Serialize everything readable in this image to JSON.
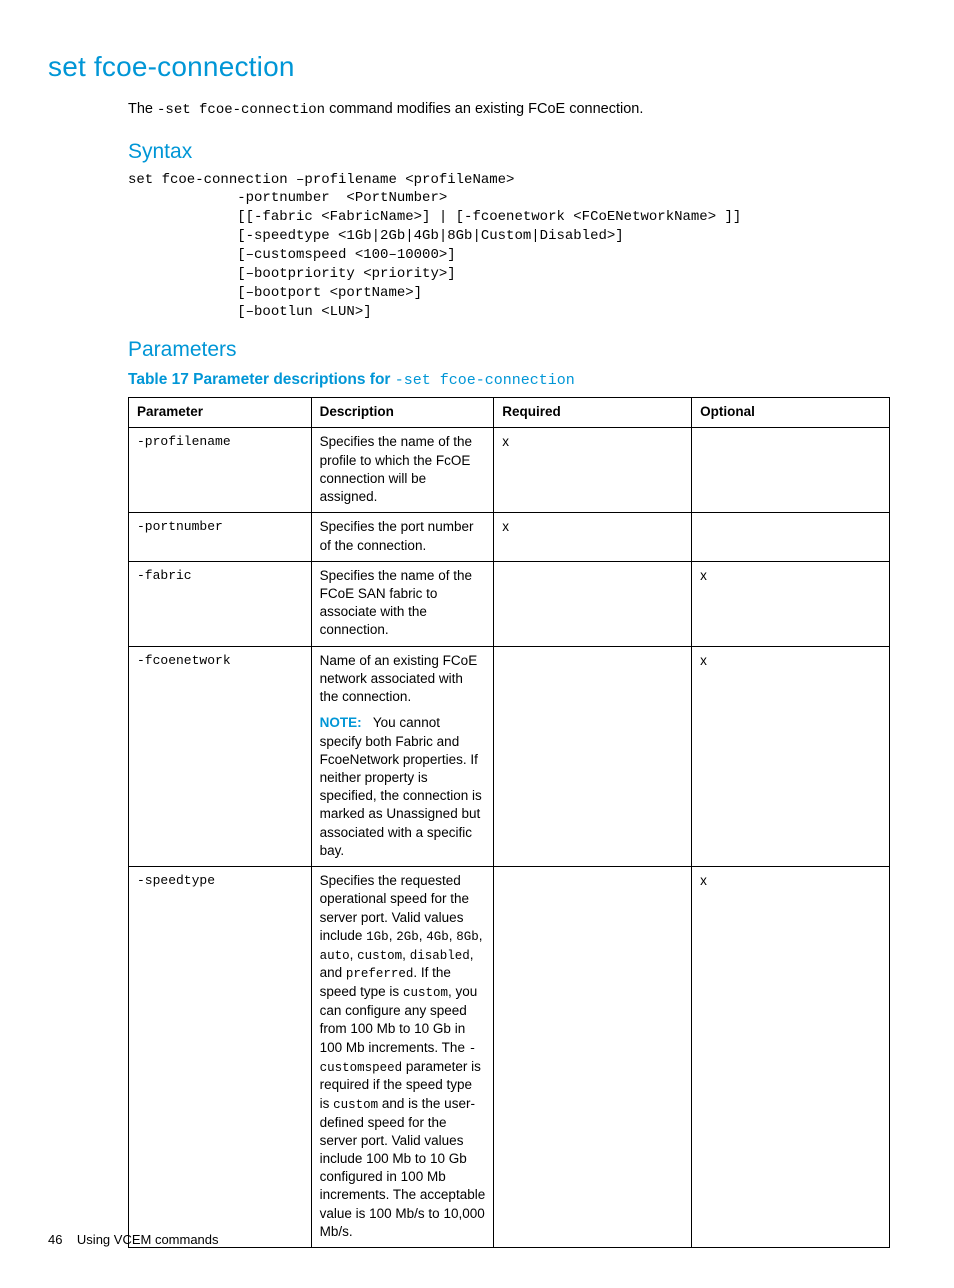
{
  "title": "set fcoe-connection",
  "intro_before": "The ",
  "intro_code": "-set fcoe-connection",
  "intro_after": " command modifies an existing FCoE connection.",
  "syntax_heading": "Syntax",
  "syntax_block": "set fcoe-connection –profilename <profileName>\n             -portnumber  <PortNumber>\n             [[-fabric <FabricName>] | [-fcoenetwork <FCoENetworkName> ]]\n             [-speedtype <1Gb|2Gb|4Gb|8Gb|Custom|Disabled>]\n             [–customspeed <100–10000>]\n             [–bootpriority <priority>]\n             [–bootport <portName>]\n             [–bootlun <LUN>]",
  "params_heading": "Parameters",
  "table_caption_prefix": "Table 17 Parameter descriptions for ",
  "table_caption_code": "-set fcoe-connection",
  "columns": {
    "parameter": "Parameter",
    "description": "Description",
    "required": "Required",
    "optional": "Optional"
  },
  "rows": [
    {
      "param": "-profilename",
      "required": "x",
      "optional": "",
      "desc_render": "plain",
      "desc_plain": "Specifies the name of the profile to which the FcOE connection will be assigned."
    },
    {
      "param": "-portnumber",
      "required": "x",
      "optional": "",
      "desc_render": "plain",
      "desc_plain": "Specifies the port number of the connection."
    },
    {
      "param": "-fabric",
      "required": "",
      "optional": "x",
      "desc_render": "plain",
      "desc_plain": "Specifies the name of the FCoE SAN fabric to associate with the connection."
    },
    {
      "param": "-fcoenetwork",
      "required": "",
      "optional": "x",
      "desc_render": "fcoenetwork",
      "fco_desc": "Name of an existing FCoE network associated with the connection.",
      "note_label": "NOTE:",
      "note_text": "You cannot specify both Fabric and FcoeNetwork properties. If neither property is specified, the connection is marked as Unassigned but associated with a specific bay."
    },
    {
      "param": "-speedtype",
      "required": "",
      "optional": "x",
      "desc_render": "speedtype",
      "sp1": "Specifies the requested operational speed for the server port. Valid values include ",
      "sp_c1": "1Gb",
      "sp2": ", ",
      "sp_c2": "2Gb",
      "sp3": ", ",
      "sp_c3": "4Gb",
      "sp4": ", ",
      "sp_c4": "8Gb",
      "sp5": ", ",
      "sp_c5": "auto",
      "sp6": ", ",
      "sp_c6": "custom",
      "sp7": ", ",
      "sp_c7": "disabled",
      "sp8": ", and ",
      "sp_c8": "preferred",
      "sp9": ". If the speed type is ",
      "sp_c9": "custom",
      "sp10": ", you can configure any speed from 100 Mb to 10 Gb in 100 Mb increments. The ",
      "sp_c10": "-customspeed",
      "sp11": " parameter is required if the speed type is ",
      "sp_c11": "custom",
      "sp12": " and is the user-defined speed for the server port. Valid values include 100 Mb to 10 Gb configured in 100 Mb increments. The acceptable value is 100 Mb/s to 10,000 Mb/s."
    }
  ],
  "footer": {
    "page": "46",
    "text": "Using VCEM commands"
  }
}
